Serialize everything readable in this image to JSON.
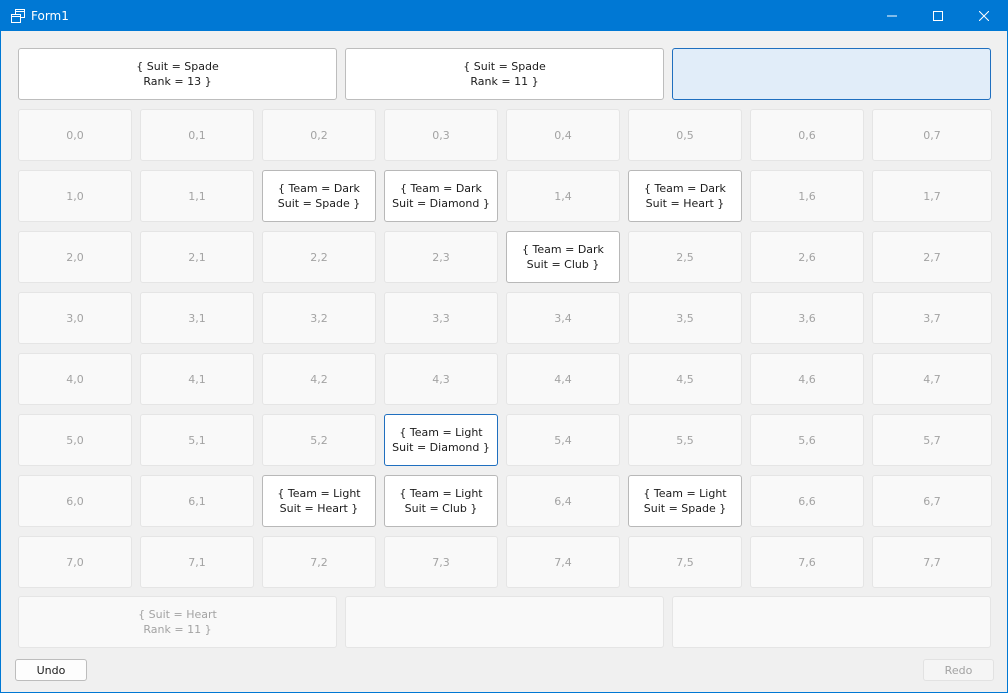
{
  "window": {
    "title": "Form1",
    "controls": {
      "minimize_icon": "minimize-icon",
      "maximize_icon": "maximize-icon",
      "close_icon": "close-icon"
    }
  },
  "top_slots": [
    {
      "text": "{ Suit = Spade\nRank = 13 }",
      "state": "filled"
    },
    {
      "text": "{ Suit = Spade\nRank = 11 }",
      "state": "filled"
    },
    {
      "text": "",
      "state": "selected"
    }
  ],
  "grid": [
    [
      "0,0",
      "0,1",
      "0,2",
      "0,3",
      "0,4",
      "0,5",
      "0,6",
      "0,7"
    ],
    [
      "1,0",
      "1,1",
      "{ Team = Dark\nSuit = Spade }",
      "{ Team = Dark\nSuit = Diamond }",
      "1,4",
      "{ Team = Dark\nSuit = Heart }",
      "1,6",
      "1,7"
    ],
    [
      "2,0",
      "2,1",
      "2,2",
      "2,3",
      "{ Team = Dark\nSuit = Club }",
      "2,5",
      "2,6",
      "2,7"
    ],
    [
      "3,0",
      "3,1",
      "3,2",
      "3,3",
      "3,4",
      "3,5",
      "3,6",
      "3,7"
    ],
    [
      "4,0",
      "4,1",
      "4,2",
      "4,3",
      "4,4",
      "4,5",
      "4,6",
      "4,7"
    ],
    [
      "5,0",
      "5,1",
      "5,2",
      "{ Team = Light\nSuit = Diamond }",
      "5,4",
      "5,5",
      "5,6",
      "5,7"
    ],
    [
      "6,0",
      "6,1",
      "{ Team = Light\nSuit = Heart }",
      "{ Team = Light\nSuit = Club }",
      "6,4",
      "{ Team = Light\nSuit = Spade }",
      "6,6",
      "6,7"
    ],
    [
      "7,0",
      "7,1",
      "7,2",
      "7,3",
      "7,4",
      "7,5",
      "7,6",
      "7,7"
    ]
  ],
  "focused_cell": "5,3",
  "bottom_slots": [
    {
      "text": "{ Suit = Heart\nRank = 11 }"
    },
    {
      "text": ""
    },
    {
      "text": ""
    }
  ],
  "buttons": {
    "undo": {
      "label": "Undo",
      "enabled": true
    },
    "redo": {
      "label": "Redo",
      "enabled": false
    }
  },
  "colors": {
    "titlebar": "#0078d4",
    "focus_border": "#1f6fbf",
    "selected_fill": "#e1edf9",
    "window_bg": "#f0f0f0"
  }
}
